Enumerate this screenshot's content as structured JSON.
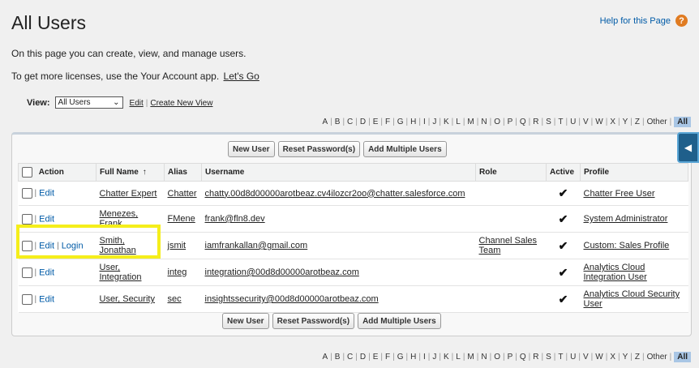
{
  "header": {
    "title": "All Users",
    "help_label": "Help for this Page",
    "help_icon": "?"
  },
  "intro": {
    "line1": "On this page you can create, view, and manage users.",
    "line2": "To get more licenses, use the Your Account app.",
    "line2_link": "Let's Go"
  },
  "view": {
    "label": "View:",
    "selected": "All Users",
    "edit_link": "Edit",
    "create_link": "Create New View"
  },
  "alphabet": [
    "A",
    "B",
    "C",
    "D",
    "E",
    "F",
    "G",
    "H",
    "I",
    "J",
    "K",
    "L",
    "M",
    "N",
    "O",
    "P",
    "Q",
    "R",
    "S",
    "T",
    "U",
    "V",
    "W",
    "X",
    "Y",
    "Z",
    "Other"
  ],
  "alphabet_all": "All",
  "buttons": {
    "new_user": "New User",
    "reset_password": "Reset Password(s)",
    "add_multiple": "Add Multiple Users"
  },
  "table": {
    "columns": [
      "Action",
      "Full Name",
      "Alias",
      "Username",
      "Role",
      "Active",
      "Profile"
    ],
    "sort_arrow": "↑",
    "edit_label": "Edit",
    "login_label": "Login",
    "rows": [
      {
        "full_name": "Chatter Expert",
        "alias": "Chatter",
        "username": "chatty.00d8d00000arotbeaz.cv4ilozcr2oo@chatter.salesforce.com",
        "role": "",
        "active": "✔",
        "profile": "Chatter Free User",
        "login": false
      },
      {
        "full_name": "Menezes, Frank",
        "alias": "FMene",
        "username": "frank@fln8.dev",
        "role": "",
        "active": "✔",
        "profile": "System Administrator",
        "login": false
      },
      {
        "full_name": "Smith, Jonathan",
        "alias": "jsmit",
        "username": "iamfrankallan@gmail.com",
        "role": "Channel Sales Team",
        "active": "✔",
        "profile": "Custom: Sales Profile",
        "login": true
      },
      {
        "full_name": "User, Integration",
        "alias": "integ",
        "username": "integration@00d8d00000arotbeaz.com",
        "role": "",
        "active": "✔",
        "profile": "Analytics Cloud Integration User",
        "login": false
      },
      {
        "full_name": "User, Security",
        "alias": "sec",
        "username": "insightssecurity@00d8d00000arotbeaz.com",
        "role": "",
        "active": "✔",
        "profile": "Analytics Cloud Security User",
        "login": false
      }
    ]
  },
  "colors": {
    "highlight": "#f5ee1b",
    "link_blue": "#015ba7",
    "side_tab": "#1f5f8b"
  }
}
